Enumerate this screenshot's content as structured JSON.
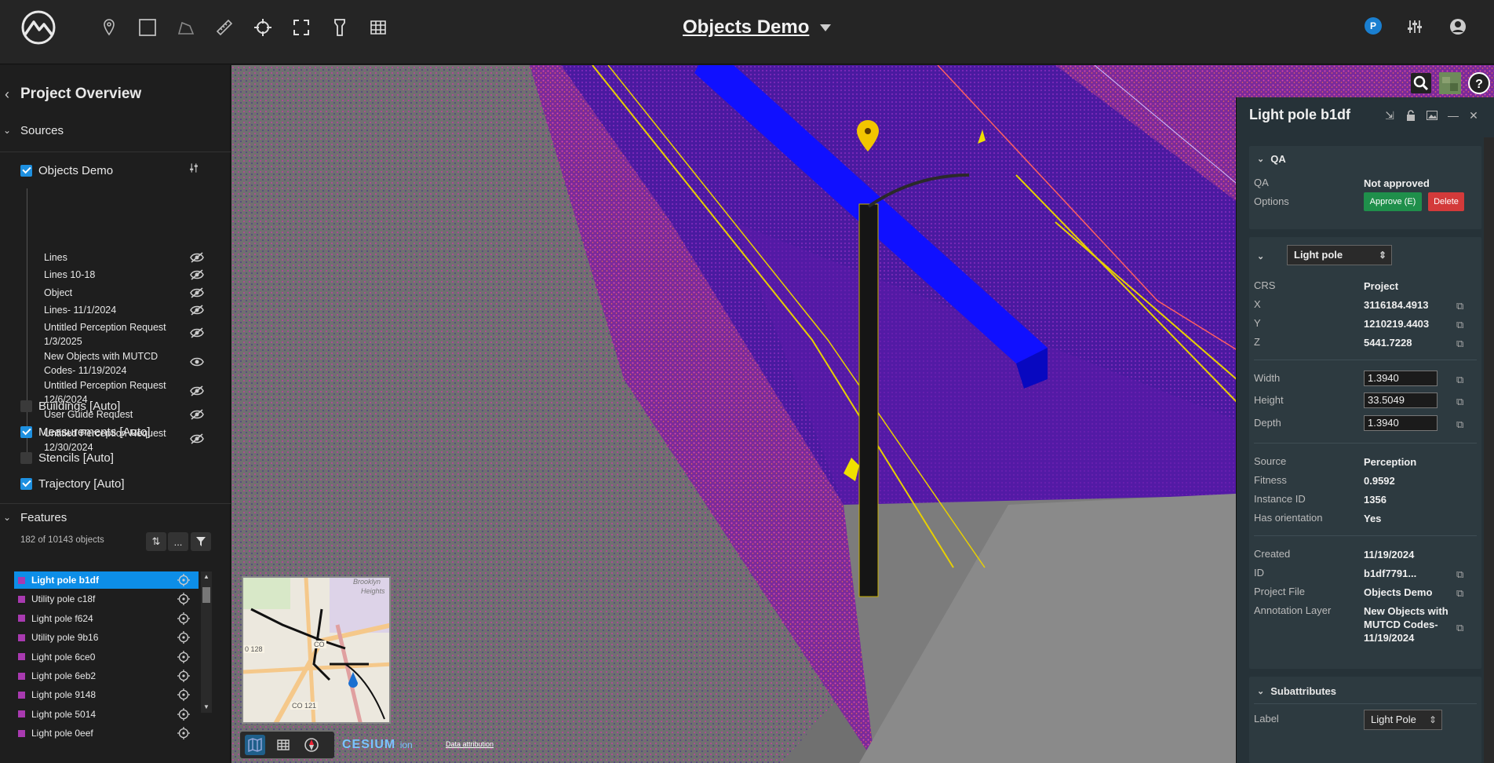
{
  "app": {
    "title": "Objects Demo",
    "user_initial": "P"
  },
  "toolbar": {
    "tools": [
      "pin-icon",
      "rectangle-icon",
      "polyline-icon",
      "ruler-icon",
      "crosshair-icon",
      "fullscreen-icon",
      "flashlight-icon",
      "grid-icon"
    ],
    "right": [
      "sliders-icon",
      "user-icon"
    ]
  },
  "sidebar": {
    "title": "Project Overview",
    "sources_label": "Sources",
    "sources": [
      {
        "label": "Objects Demo",
        "checked": true
      },
      {
        "label": "Buildings [Auto]",
        "checked": false
      },
      {
        "label": "Measurements [Auto]",
        "checked": true
      },
      {
        "label": "Stencils [Auto]",
        "checked": false
      },
      {
        "label": "Trajectory [Auto]",
        "checked": true
      }
    ],
    "layers": [
      {
        "l1": "Lines",
        "l2": "",
        "visible": false
      },
      {
        "l1": "Lines 10-18",
        "l2": "",
        "visible": false
      },
      {
        "l1": "Object",
        "l2": "",
        "visible": false
      },
      {
        "l1": "Lines- 11/1/2024",
        "l2": "",
        "visible": false
      },
      {
        "l1": "Untitled Perception Request",
        "l2": "1/3/2025",
        "visible": false
      },
      {
        "l1": "New Objects with MUTCD",
        "l2": "Codes- 11/19/2024",
        "visible": true
      },
      {
        "l1": "Untitled Perception Request",
        "l2": "12/6/2024",
        "visible": false
      },
      {
        "l1": "User Guide Request",
        "l2": "",
        "visible": false
      },
      {
        "l1": "Untitled Perception Request",
        "l2": "12/30/2024",
        "visible": false
      }
    ],
    "features_label": "Features",
    "features_count": "182 of 10143 objects",
    "features_more": "...",
    "features": [
      "Light pole b1df",
      "Utility pole c18f",
      "Light pole f624",
      "Utility pole 9b16",
      "Light pole 6ce0",
      "Light pole 6eb2",
      "Light pole 9148",
      "Light pole 5014",
      "Light pole 0eef"
    ]
  },
  "map": {
    "cesium_brand": "CESIUM",
    "cesium_suffix": "ion",
    "attribution": "Data attribution",
    "labels": {
      "a": "Brooklyn",
      "b": "Heights",
      "c": "CO",
      "d": "0 128",
      "e": "CO 121"
    }
  },
  "panel": {
    "title": "Light pole b1df",
    "qa_section": "QA",
    "qa_label": "QA",
    "qa_value": "Not approved",
    "options_label": "Options",
    "approve": "Approve (E)",
    "delete": "Delete",
    "class_select": "Light pole",
    "crs_label": "CRS",
    "crs_value": "Project",
    "x_label": "X",
    "x_value": "3116184.4913",
    "y_label": "Y",
    "y_value": "1210219.4403",
    "z_label": "Z",
    "z_value": "5441.7228",
    "width_label": "Width",
    "width_value": "1.3940",
    "height_label": "Height",
    "height_value": "33.5049",
    "depth_label": "Depth",
    "depth_value": "1.3940",
    "source_label": "Source",
    "source_value": "Perception",
    "fitness_label": "Fitness",
    "fitness_value": "0.9592",
    "instance_label": "Instance ID",
    "instance_value": "1356",
    "orient_label": "Has orientation",
    "orient_value": "Yes",
    "created_label": "Created",
    "created_value": "11/19/2024",
    "id_label": "ID",
    "id_value": "b1df7791...",
    "pfile_label": "Project File",
    "pfile_value": "Objects Demo",
    "alayer_label": "Annotation Layer",
    "alayer_value": "New Objects with MUTCD Codes- 11/19/2024",
    "subattr_section": "Subattributes",
    "sub_label": "Label",
    "sub_value": "Light Pole"
  },
  "colors": {
    "accent": "#0d8ee8",
    "approve": "#1f8f4b",
    "delete": "#d33a3a",
    "marker": "#f2c500",
    "object": "#1010ff"
  }
}
